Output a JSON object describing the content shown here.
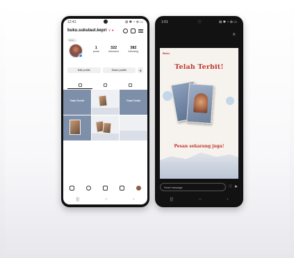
{
  "left_phone": {
    "status_time": "12:41",
    "status_icons": "⊠ ✱ ◔ ⊜ ▭",
    "username": "buku.sukulaut.kepri",
    "username_suffix": "∨ ●",
    "avatar_note": "Note...",
    "stats": [
      {
        "value": "1",
        "label": "posts"
      },
      {
        "value": "322",
        "label": "followers"
      },
      {
        "value": "382",
        "label": "following"
      }
    ],
    "buttons": {
      "edit": "Edit profile",
      "share": "Share profile",
      "add_person": "⊕"
    },
    "grid_cells": [
      {
        "style": "blue",
        "title": "Telah Terbit!"
      },
      {
        "style": "light",
        "title": ""
      },
      {
        "style": "blue",
        "title": "Telah Terbit!"
      },
      {
        "style": "blue",
        "title": ""
      },
      {
        "style": "light",
        "title": ""
      },
      {
        "style": "light",
        "title": ""
      }
    ],
    "nav_icons": [
      "home-icon",
      "search-icon",
      "add-icon",
      "reels-icon",
      "profile-avatar"
    ],
    "system_nav": [
      "|||",
      "○",
      "‹"
    ]
  },
  "right_phone": {
    "status_time": "1:01",
    "status_icons": "⊠ ✱ ◔ ⊜ ▭",
    "close": "×",
    "logo_text": "Buku",
    "headline": "Telah Terbit!",
    "cta": "Pesan sekarang juga!",
    "message_placeholder": "Send message",
    "heart": "♡",
    "send": "➤",
    "system_nav": [
      "|||",
      "○",
      "‹"
    ]
  }
}
